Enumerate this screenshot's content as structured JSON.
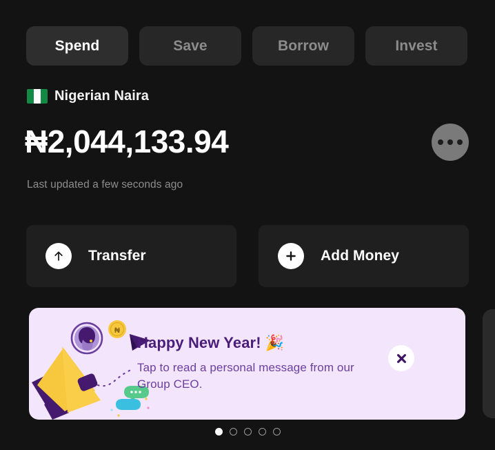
{
  "tabs": [
    {
      "label": "Spend",
      "active": true
    },
    {
      "label": "Save",
      "active": false
    },
    {
      "label": "Borrow",
      "active": false
    },
    {
      "label": "Invest",
      "active": false
    }
  ],
  "account": {
    "currency_name": "Nigerian Naira",
    "flag": "nigeria-flag",
    "balance": "₦2,044,133.94",
    "last_updated": "Last updated a few seconds ago",
    "more_icon": "ellipsis-icon"
  },
  "actions": [
    {
      "label": "Transfer",
      "icon": "arrow-up-icon"
    },
    {
      "label": "Add Money",
      "icon": "plus-icon"
    }
  ],
  "banner": {
    "title": "Happy New Year! 🎉",
    "body": "Tap to read a personal message from our Group CEO.",
    "close_icon": "close-icon",
    "art": "megaphone-announcement-illustration",
    "background": "#f3e5fc",
    "title_color": "#4a1d7a",
    "body_color": "#6b3fa0"
  },
  "carousel": {
    "total": 5,
    "active_index": 0
  },
  "colors": {
    "page_background": "#131313",
    "card_background": "#1f1f1f",
    "tab_background": "#272727",
    "active_tab_text": "#ffffff",
    "inactive_tab_text": "#8c8c8c",
    "muted_text": "#8e8e8e"
  }
}
